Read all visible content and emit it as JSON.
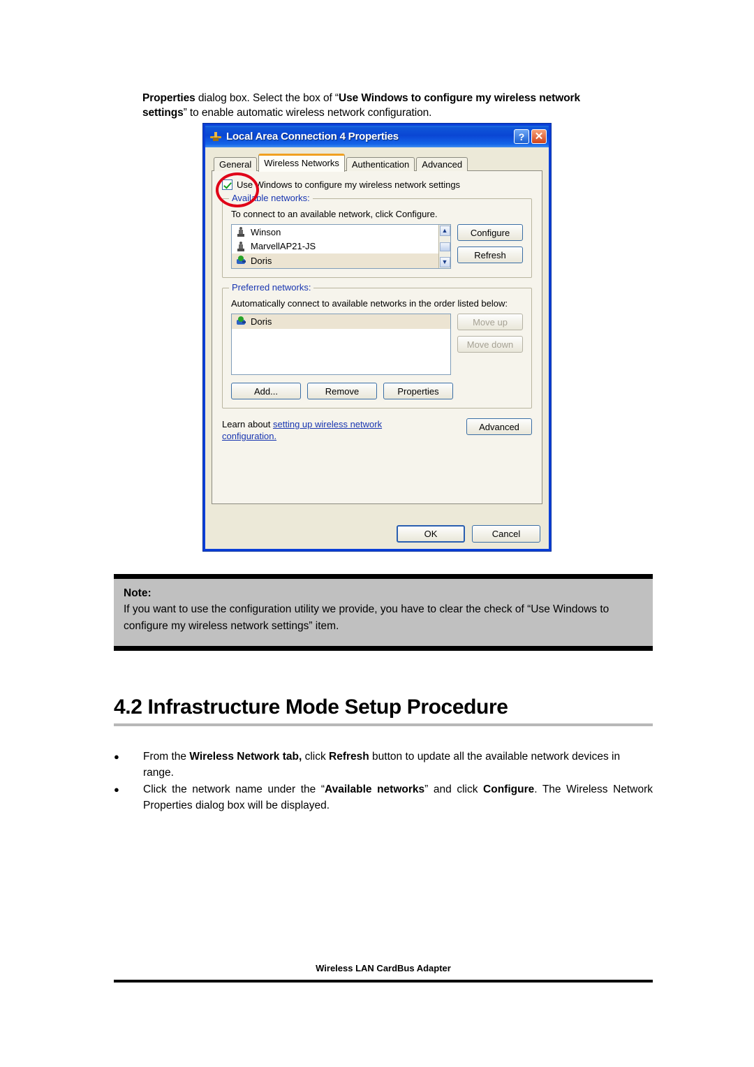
{
  "intro": {
    "bold1": "Properties",
    "mid1": " dialog box. Select the box of “",
    "bold2": "Use Windows to configure my wireless network settings",
    "mid2": "” to enable automatic wireless network configuration."
  },
  "dialog": {
    "title": "Local Area Connection 4 Properties",
    "titlebar_icon": "network-connection-icon",
    "help_button": "?",
    "close_button": "✕",
    "tabs": [
      {
        "label": "General",
        "active": false
      },
      {
        "label": "Wireless Networks",
        "active": true
      },
      {
        "label": "Authentication",
        "active": false
      },
      {
        "label": "Advanced",
        "active": false
      }
    ],
    "use_windows_checkbox": {
      "label": "Use Windows to configure my wireless network settings",
      "checked": true,
      "annotation": "red-ellipse-highlight"
    },
    "available_networks": {
      "legend": "Available networks:",
      "hint": "To connect to an available network, click Configure.",
      "items": [
        {
          "name": "Winson",
          "icon": "adhoc-network-icon",
          "selected": false
        },
        {
          "name": "MarvellAP21-JS",
          "icon": "adhoc-network-icon",
          "selected": false
        },
        {
          "name": "Doris",
          "icon": "access-point-icon",
          "selected": true
        }
      ],
      "buttons": [
        {
          "label": "Configure",
          "disabled": false
        },
        {
          "label": "Refresh",
          "disabled": false
        }
      ]
    },
    "preferred_networks": {
      "legend": "Preferred networks:",
      "hint": "Automatically connect to available networks in the order listed below:",
      "items": [
        {
          "name": "Doris",
          "icon": "access-point-icon",
          "selected": true
        }
      ],
      "side_buttons": [
        {
          "label": "Move up",
          "disabled": true
        },
        {
          "label": "Move down",
          "disabled": true
        }
      ],
      "bottom_buttons": [
        {
          "label": "Add...",
          "disabled": false
        },
        {
          "label": "Remove",
          "disabled": false
        },
        {
          "label": "Properties",
          "disabled": false
        }
      ]
    },
    "learn": {
      "prefix": "Learn about ",
      "link": "setting up wireless network configuration.",
      "advanced_button": "Advanced"
    },
    "footer_buttons": [
      {
        "label": "OK",
        "default": true
      },
      {
        "label": "Cancel",
        "default": false
      }
    ]
  },
  "note": {
    "title": "Note:",
    "text": "If you want to use the configuration utility we provide, you have to clear the check of “Use Windows to configure my wireless network settings” item."
  },
  "section": {
    "heading": "4.2 Infrastructure Mode Setup Procedure"
  },
  "bullets": [
    {
      "marker": "●",
      "p1": "From the ",
      "b1": "Wireless Network tab,",
      "p2": " click ",
      "b2": "Refresh",
      "p3": " button to update all the available network devices in range."
    },
    {
      "marker": "●",
      "p1": "Click the network name under the “",
      "b1": "Available networks",
      "p2": "” and click ",
      "b2": "Configure",
      "p3": ". The Wireless Network Properties dialog box will be displayed."
    }
  ],
  "page_footer": {
    "text": "Wireless LAN CardBus Adapter"
  },
  "colors": {
    "titlebar_blue": "#0a46d4",
    "dialog_face": "#ece9d8",
    "link_blue": "#1835b0",
    "annotation_red": "#e00018",
    "active_tab_accent": "#f0a020",
    "note_fill": "#c0c0c0"
  }
}
